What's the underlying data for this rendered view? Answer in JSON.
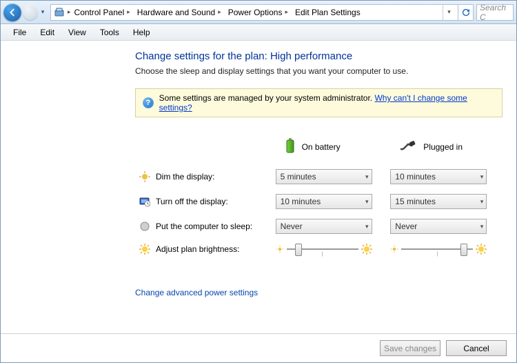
{
  "nav": {
    "breadcrumb": [
      "Control Panel",
      "Hardware and Sound",
      "Power Options",
      "Edit Plan Settings"
    ],
    "search_placeholder": "Search C"
  },
  "menu": [
    "File",
    "Edit",
    "View",
    "Tools",
    "Help"
  ],
  "page": {
    "title": "Change settings for the plan: High performance",
    "description": "Choose the sleep and display settings that you want your computer to use.",
    "notice_text": "Some settings are managed by your system administrator.",
    "notice_link": "Why can't I change some settings?",
    "col_battery": "On battery",
    "col_plugged": "Plugged in",
    "rows": {
      "dim": {
        "label": "Dim the display:",
        "battery": "5 minutes",
        "plugged": "10 minutes"
      },
      "turnoff": {
        "label": "Turn off the display:",
        "battery": "10 minutes",
        "plugged": "15 minutes"
      },
      "sleep": {
        "label": "Put the computer to sleep:",
        "battery": "Never",
        "plugged": "Never"
      },
      "bright": {
        "label": "Adjust plan brightness:"
      }
    },
    "brightness": {
      "battery_pct": 12,
      "plugged_pct": 82
    },
    "advanced_link": "Change advanced power settings"
  },
  "footer": {
    "save": "Save changes",
    "cancel": "Cancel"
  }
}
